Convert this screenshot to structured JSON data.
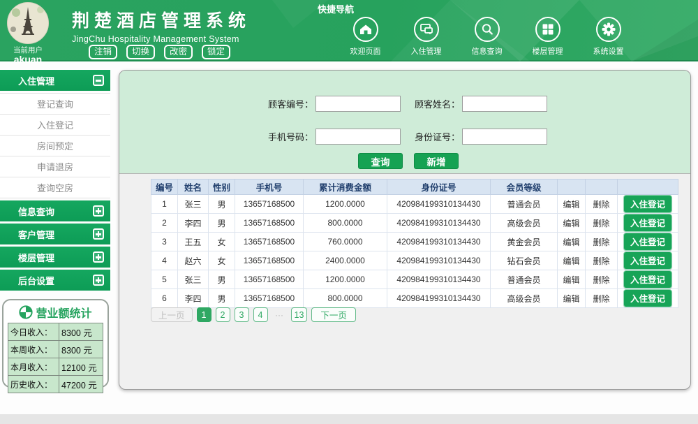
{
  "colors": {
    "brand_green": "#27a25d",
    "button_green": "#16a253",
    "light_green_panel": "#cfecd8",
    "table_header_bg": "#d8e4f2",
    "table_header_text": "#22406e",
    "pagination_active": "#2fa863",
    "stats_cell_bg": "#c8e7cc"
  },
  "header": {
    "user_label": "当前用户",
    "username": "akuan",
    "logo_icon": "eiffel-tower-logo",
    "title": "荆楚酒店管理系统",
    "subtitle": "JingChu Hospitality Management System",
    "actions": [
      "注销",
      "切换",
      "改密",
      "锁定"
    ],
    "quick_nav_label": "快捷导航",
    "nav_items": [
      {
        "icon": "home-icon",
        "label": "欢迎页面"
      },
      {
        "icon": "monitor-icon",
        "label": "入住管理"
      },
      {
        "icon": "search-icon",
        "label": "信息查询"
      },
      {
        "icon": "grid-icon",
        "label": "楼层管理"
      },
      {
        "icon": "gear-icon",
        "label": "系统设置"
      }
    ]
  },
  "sidebar": {
    "sections": [
      {
        "label": "入住管理",
        "toggle": "minus",
        "items": [
          "登记查询",
          "入住登记",
          "房间预定",
          "申请退房",
          "查询空房"
        ]
      },
      {
        "label": "信息查询",
        "toggle": "plus",
        "items": []
      },
      {
        "label": "客户管理",
        "toggle": "plus",
        "items": []
      },
      {
        "label": "楼层管理",
        "toggle": "plus",
        "items": []
      },
      {
        "label": "后台设置",
        "toggle": "plus",
        "items": []
      }
    ]
  },
  "stats": {
    "title": "营业额统计",
    "icon": "pie-chart-icon",
    "rows": [
      {
        "label": "今日收入：",
        "value": "8300 元"
      },
      {
        "label": "本周收入：",
        "value": "8300 元"
      },
      {
        "label": "本月收入：",
        "value": "12100 元"
      },
      {
        "label": "历史收入：",
        "value": "47200 元"
      }
    ]
  },
  "search_form": {
    "fields": [
      {
        "label": "顾客编号：",
        "value": "",
        "placeholder": ""
      },
      {
        "label": "顾客姓名：",
        "value": "",
        "placeholder": ""
      },
      {
        "label": "手机号码：",
        "value": "",
        "placeholder": ""
      },
      {
        "label": "身份证号：",
        "value": "",
        "placeholder": ""
      }
    ],
    "query_button": "查询",
    "add_button": "新增"
  },
  "table": {
    "headers": [
      "编号",
      "姓名",
      "性别",
      "手机号",
      "累计消费金额",
      "身份证号",
      "会员等级",
      "",
      "",
      ""
    ],
    "edit_label": "编辑",
    "delete_label": "删除",
    "checkin_label": "入住登记",
    "rows": [
      {
        "no": "1",
        "name": "张三",
        "gender": "男",
        "phone": "13657168500",
        "amount": "1200.0000",
        "id_number": "420984199310134430",
        "level": "普通会员"
      },
      {
        "no": "2",
        "name": "李四",
        "gender": "男",
        "phone": "13657168500",
        "amount": "800.0000",
        "id_number": "420984199310134430",
        "level": "高级会员"
      },
      {
        "no": "3",
        "name": "王五",
        "gender": "女",
        "phone": "13657168500",
        "amount": "760.0000",
        "id_number": "420984199310134430",
        "level": "黄金会员"
      },
      {
        "no": "4",
        "name": "赵六",
        "gender": "女",
        "phone": "13657168500",
        "amount": "2400.0000",
        "id_number": "420984199310134430",
        "level": "钻石会员"
      },
      {
        "no": "5",
        "name": "张三",
        "gender": "男",
        "phone": "13657168500",
        "amount": "1200.0000",
        "id_number": "420984199310134430",
        "level": "普通会员"
      },
      {
        "no": "6",
        "name": "李四",
        "gender": "男",
        "phone": "13657168500",
        "amount": "800.0000",
        "id_number": "420984199310134430",
        "level": "高级会员"
      }
    ]
  },
  "pagination": {
    "prev": "上一页",
    "pages": [
      "1",
      "2",
      "3",
      "4"
    ],
    "active": "1",
    "ellipsis": "···",
    "last_page": "13",
    "next": "下一页"
  }
}
